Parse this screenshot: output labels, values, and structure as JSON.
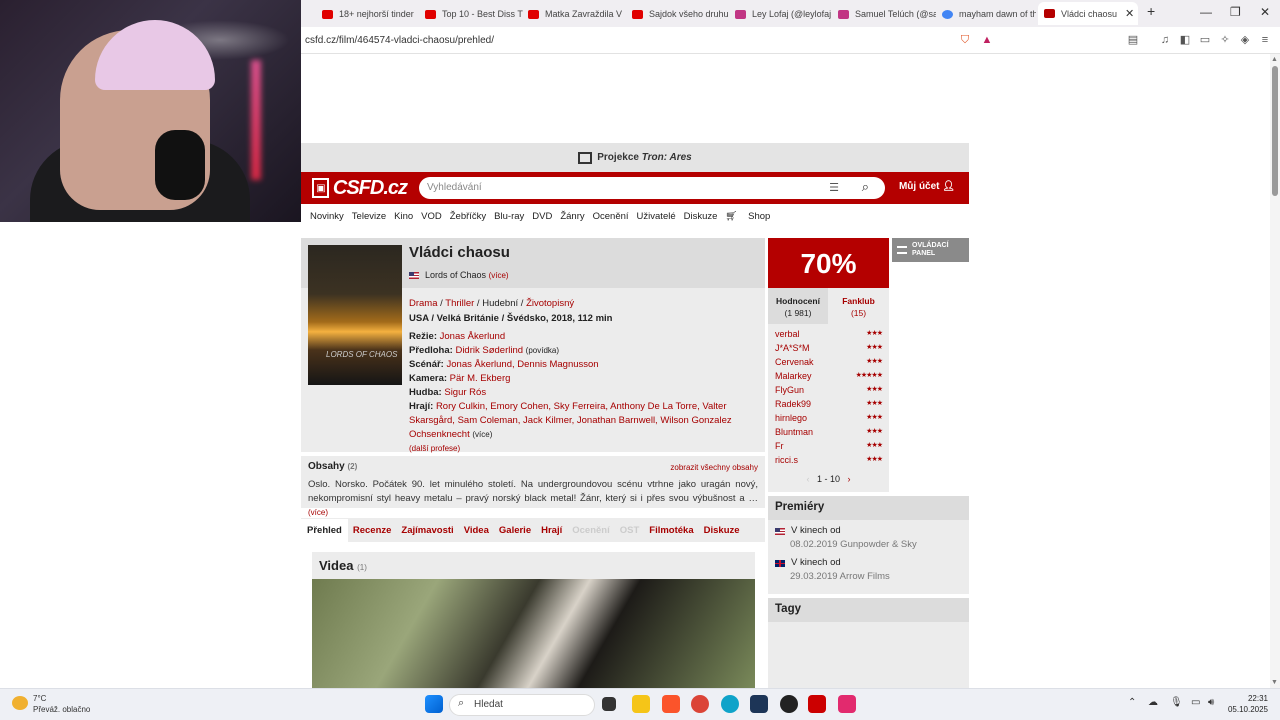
{
  "browser": {
    "tabs": [
      {
        "label": "18+ nejhorší tinder",
        "color": "#e00000"
      },
      {
        "label": "Top 10 - Best Diss Tr",
        "color": "#e00000"
      },
      {
        "label": "Matka Zavraždila V",
        "color": "#e00000"
      },
      {
        "label": "Sajdok všeho druhu",
        "color": "#e00000"
      },
      {
        "label": "Ley Lofaj (@leylofaj",
        "color": "#c13584"
      },
      {
        "label": "Samuel Telúch (@sa",
        "color": "#c13584"
      },
      {
        "label": "mayham dawn of th",
        "color": "#4285f4"
      },
      {
        "label": "Vládci chaosu",
        "color": "#b40000"
      }
    ],
    "url": "csfd.cz/film/464574-vladci-chaosu/prehled/",
    "new_tab": "+",
    "close_tab": "✕"
  },
  "promo": {
    "text": "Projekce",
    "highlight": "Tron: Ares"
  },
  "header": {
    "logo": "CSFD.cz",
    "search_placeholder": "Vyhledávání",
    "account": "Můj účet"
  },
  "nav": [
    "Novinky",
    "Televize",
    "Kino",
    "VOD",
    "Žebříčky",
    "Blu-ray",
    "DVD",
    "Žánry",
    "Ocenění",
    "Uživatelé",
    "Diskuze",
    "Shop"
  ],
  "film": {
    "title": "Vládci chaosu",
    "original_title": "Lords of Chaos",
    "more": "(více)",
    "poster_text": "LORDS OF CHAOS",
    "genres": [
      "Drama",
      "Thriller",
      "Hudební",
      "Životopisný"
    ],
    "origin": "USA / Velká Británie / Švédsko, 2018, 112 min",
    "crew": {
      "rezie_label": "Režie:",
      "rezie": "Jonas Åkerlund",
      "predloha_label": "Předloha:",
      "predloha": "Didrik Søderlind",
      "predloha_note": "(povídka)",
      "scenar_label": "Scénář:",
      "scenar": "Jonas Åkerlund, Dennis Magnusson",
      "kamera_label": "Kamera:",
      "kamera": "Pär M. Ekberg",
      "hudba_label": "Hudba:",
      "hudba": "Sigur Rós",
      "hraji_label": "Hrají:",
      "hraji": "Rory Culkin, Emory Cohen, Sky Ferreira, Anthony De La Torre, Valter Skarsgård, Sam Coleman, Jack Kilmer, Jonathan Barnwell, Wilson Gonzalez Ochsenknecht",
      "more": "(více)",
      "more_prof": "(další profese)"
    }
  },
  "plot": {
    "heading": "Obsahy",
    "count": "(2)",
    "show_all": "zobrazit všechny obsahy",
    "text": "Oslo. Norsko. Počátek 90. let minulého století. Na undergroundovou scénu vtrhne jako uragán nový, nekompromisní styl heavy metalu – pravý norský black metal! Žánr, který si i přes svou výbušnost a …",
    "more": "(více)"
  },
  "tabs": [
    {
      "label": "Přehled",
      "state": "active"
    },
    {
      "label": "Recenze",
      "state": "normal"
    },
    {
      "label": "Zajímavosti",
      "state": "normal"
    },
    {
      "label": "Videa",
      "state": "normal"
    },
    {
      "label": "Galerie",
      "state": "normal"
    },
    {
      "label": "Hrají",
      "state": "normal"
    },
    {
      "label": "Ocenění",
      "state": "disabled"
    },
    {
      "label": "OST",
      "state": "disabled"
    },
    {
      "label": "Filmotéka",
      "state": "normal"
    },
    {
      "label": "Diskuze",
      "state": "normal"
    }
  ],
  "videos": {
    "heading": "Videa",
    "count": "(1)"
  },
  "rating": {
    "percent": "70%",
    "tab1_label": "Hodnocení",
    "tab1_count": "(1 981)",
    "tab2_label": "Fanklub",
    "tab2_count": "(15)",
    "users": [
      {
        "name": "verbal",
        "stars": 3
      },
      {
        "name": "J*A*S*M",
        "stars": 3
      },
      {
        "name": "Cervenak",
        "stars": 3
      },
      {
        "name": "Malarkey",
        "stars": 5
      },
      {
        "name": "FlyGun",
        "stars": 3
      },
      {
        "name": "Radek99",
        "stars": 3
      },
      {
        "name": "hirnlego",
        "stars": 3
      },
      {
        "name": "Bluntman",
        "stars": 3
      },
      {
        "name": "Fr",
        "stars": 3
      },
      {
        "name": "ricci.s",
        "stars": 3
      }
    ],
    "pager": "1 - 10"
  },
  "panel": {
    "line1": "OVLÁDACÍ",
    "line2": "PANEL"
  },
  "premiery": {
    "heading": "Premiéry",
    "items": [
      {
        "label": "V kinech od",
        "detail": "08.02.2019 Gunpowder & Sky",
        "flag": "us"
      },
      {
        "label": "V kinech od",
        "detail": "29.03.2019 Arrow Films",
        "flag": "uk"
      }
    ]
  },
  "tagy": {
    "heading": "Tagy"
  },
  "taskbar": {
    "temp": "7°C",
    "weather": "Převáž. oblačno",
    "search": "Hledat",
    "time": "22:31",
    "date": "05.10.2025"
  }
}
